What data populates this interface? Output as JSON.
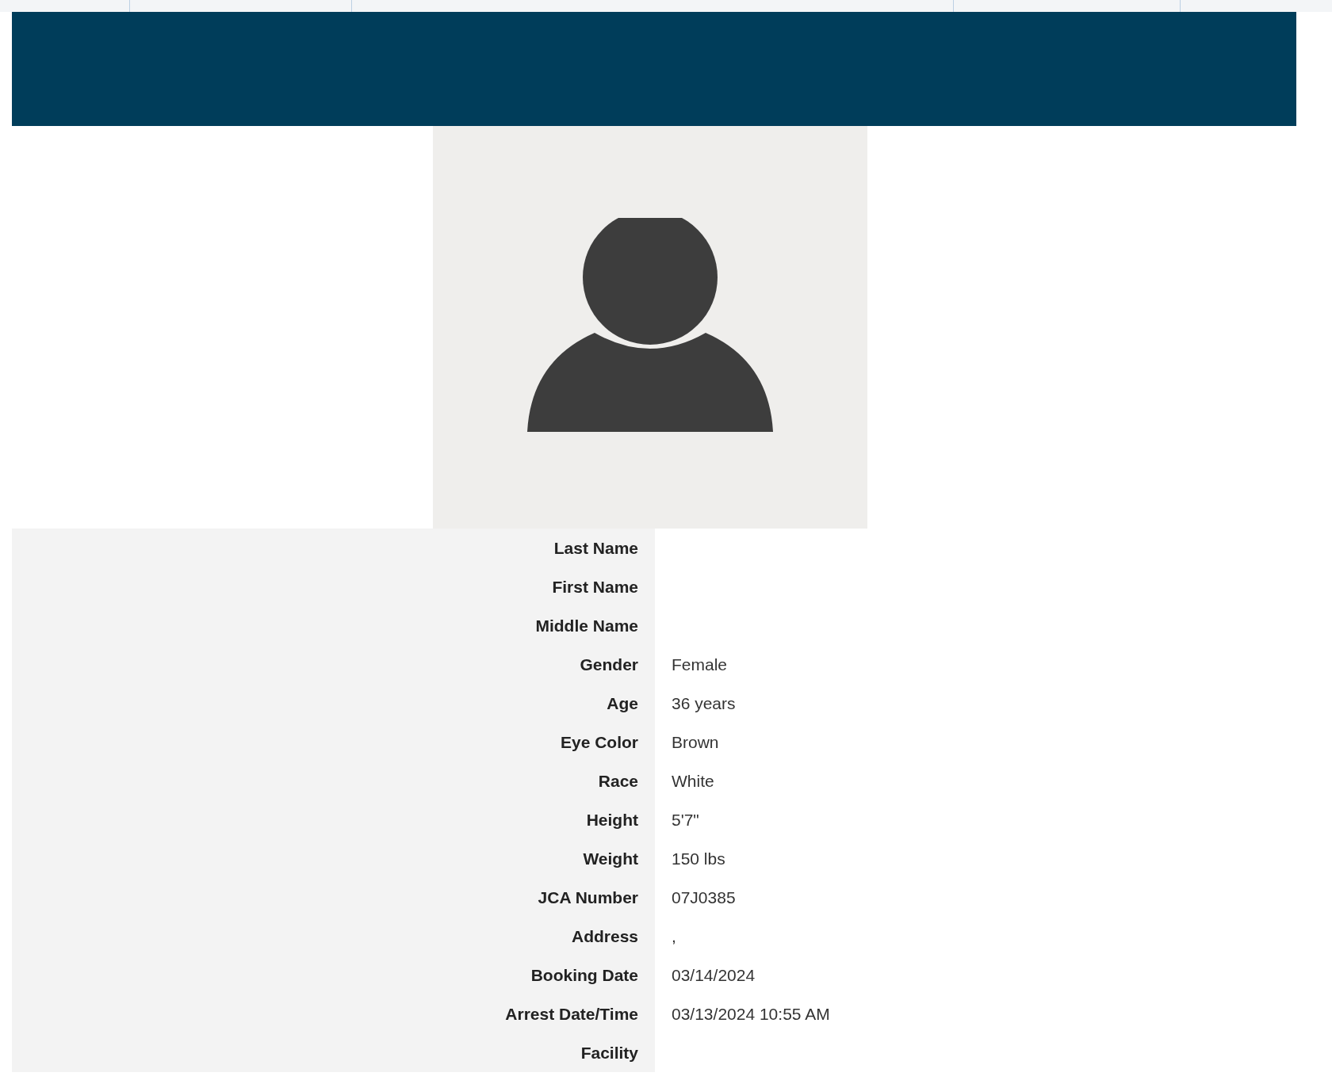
{
  "details": [
    {
      "label": "Last Name"
    },
    {
      "label": "First Name"
    },
    {
      "label": "Middle Name"
    },
    {
      "label": "Gender",
      "value": "Female"
    },
    {
      "label": "Age",
      "value": "36 years"
    },
    {
      "label": "Eye Color",
      "value": "Brown"
    },
    {
      "label": "Race",
      "value": "White"
    },
    {
      "label": "Height",
      "value": "5'7\""
    },
    {
      "label": "Weight",
      "value": "150 lbs"
    },
    {
      "label": "JCA Number",
      "value": "07J0385"
    },
    {
      "label": "Address",
      "value": ","
    },
    {
      "label": "Booking Date",
      "value": "03/14/2024"
    },
    {
      "label": "Arrest Date/Time",
      "value": "03/13/2024 10:55 AM"
    },
    {
      "label": "Facility"
    }
  ]
}
